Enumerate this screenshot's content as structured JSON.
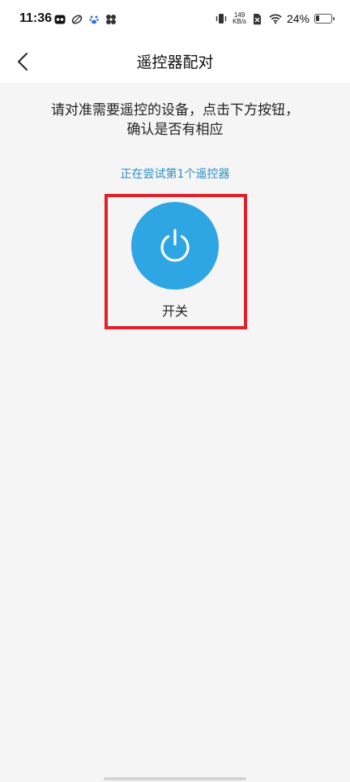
{
  "status_bar": {
    "time": "11:36",
    "net_speed_value": "149",
    "net_speed_unit": "KB/s",
    "battery_percent": "24%",
    "battery_level": 0.24
  },
  "header": {
    "title": "遥控器配对"
  },
  "main": {
    "instruction_line1": "请对准需要遥控的设备，点击下方按钮，",
    "instruction_line2": "确认是否有相应",
    "attempt_text": "正在尝试第1个遥控器",
    "power_button_label": "开关",
    "accent_color": "#2ea6e4",
    "highlight_color": "#e0202b"
  }
}
